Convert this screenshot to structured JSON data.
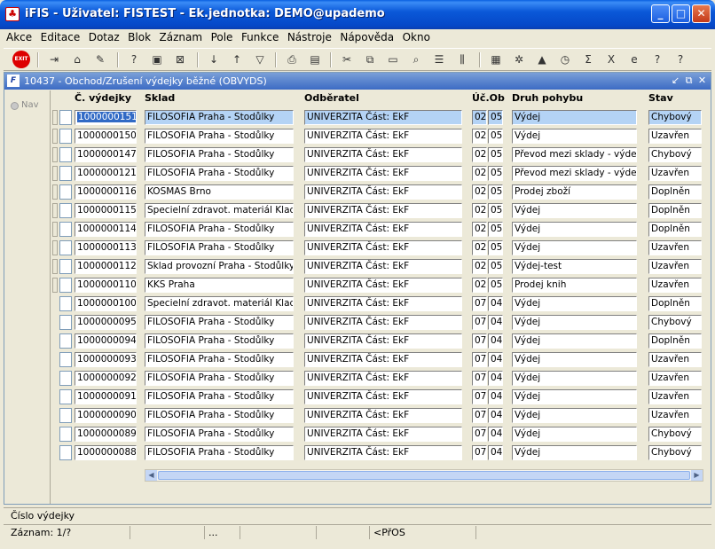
{
  "window": {
    "title": "iFIS - Uživatel: FISTEST - Ek.jednotka: DEMO@upademo",
    "app_icon": "iFIS-app-icon"
  },
  "menu": [
    "Akce",
    "Editace",
    "Dotaz",
    "Blok",
    "Záznam",
    "Pole",
    "Funkce",
    "Nástroje",
    "Nápověda",
    "Okno"
  ],
  "toolbar": {
    "exit_label": "EXIT"
  },
  "form": {
    "title": "10437 - Obchod/Zrušení výdejky běžné (OBVYDS)",
    "nav_label": "Nav"
  },
  "columns": {
    "cislo": "Č. výdejky",
    "sklad": "Sklad",
    "odberatel": "Odběratel",
    "ucob": "Úč.Ob",
    "druh": "Druh pohybu",
    "stav": "Stav"
  },
  "rows": [
    {
      "cislo": "1000000151",
      "sklad": "FILOSOFIA Praha - Stodůlky",
      "odberatel": "UNIVERZITA Část: EkF",
      "uc": "02",
      "ob": "05",
      "druh": "Výdej",
      "stav": "Chybový"
    },
    {
      "cislo": "1000000150",
      "sklad": "FILOSOFIA Praha - Stodůlky",
      "odberatel": "UNIVERZITA Část: EkF",
      "uc": "02",
      "ob": "05",
      "druh": "Výdej",
      "stav": "Uzavřen"
    },
    {
      "cislo": "1000000147",
      "sklad": "FILOSOFIA Praha - Stodůlky",
      "odberatel": "UNIVERZITA Část: EkF",
      "uc": "02",
      "ob": "05",
      "druh": "Převod mezi sklady - výdej",
      "stav": "Chybový"
    },
    {
      "cislo": "1000000121",
      "sklad": "FILOSOFIA Praha - Stodůlky",
      "odberatel": "UNIVERZITA Část: EkF",
      "uc": "02",
      "ob": "05",
      "druh": "Převod mezi sklady - výdej",
      "stav": "Uzavřen"
    },
    {
      "cislo": "1000000116",
      "sklad": "KOSMAS Brno",
      "odberatel": "UNIVERZITA Část: EkF",
      "uc": "02",
      "ob": "05",
      "druh": "Prodej zboží",
      "stav": "Doplněn"
    },
    {
      "cislo": "1000000115",
      "sklad": "Specielní zdravot. materiál Kladno",
      "odberatel": "UNIVERZITA Část: EkF",
      "uc": "02",
      "ob": "05",
      "druh": "Výdej",
      "stav": "Doplněn"
    },
    {
      "cislo": "1000000114",
      "sklad": "FILOSOFIA Praha - Stodůlky",
      "odberatel": "UNIVERZITA Část: EkF",
      "uc": "02",
      "ob": "05",
      "druh": "Výdej",
      "stav": "Doplněn"
    },
    {
      "cislo": "1000000113",
      "sklad": "FILOSOFIA Praha - Stodůlky",
      "odberatel": "UNIVERZITA Část: EkF",
      "uc": "02",
      "ob": "05",
      "druh": "Výdej",
      "stav": "Uzavřen"
    },
    {
      "cislo": "1000000112",
      "sklad": "Sklad provozní Praha - Stodůlky",
      "odberatel": "UNIVERZITA Část: EkF",
      "uc": "02",
      "ob": "05",
      "druh": "Výdej-test",
      "stav": "Uzavřen"
    },
    {
      "cislo": "1000000110",
      "sklad": "KKS Praha",
      "odberatel": "UNIVERZITA Část: EkF",
      "uc": "02",
      "ob": "05",
      "druh": "Prodej knih",
      "stav": "Uzavřen"
    },
    {
      "cislo": "1000000100",
      "sklad": "Specielní zdravot. materiál Kladno",
      "odberatel": "UNIVERZITA Část: EkF",
      "uc": "07",
      "ob": "04",
      "druh": "Výdej",
      "stav": "Doplněn"
    },
    {
      "cislo": "1000000095",
      "sklad": "FILOSOFIA Praha - Stodůlky",
      "odberatel": "UNIVERZITA Část: EkF",
      "uc": "07",
      "ob": "04",
      "druh": "Výdej",
      "stav": "Chybový"
    },
    {
      "cislo": "1000000094",
      "sklad": "FILOSOFIA Praha - Stodůlky",
      "odberatel": "UNIVERZITA Část: EkF",
      "uc": "07",
      "ob": "04",
      "druh": "Výdej",
      "stav": "Doplněn"
    },
    {
      "cislo": "1000000093",
      "sklad": "FILOSOFIA Praha - Stodůlky",
      "odberatel": "UNIVERZITA Část: EkF",
      "uc": "07",
      "ob": "04",
      "druh": "Výdej",
      "stav": "Uzavřen"
    },
    {
      "cislo": "1000000092",
      "sklad": "FILOSOFIA Praha - Stodůlky",
      "odberatel": "UNIVERZITA Část: EkF",
      "uc": "07",
      "ob": "04",
      "druh": "Výdej",
      "stav": "Uzavřen"
    },
    {
      "cislo": "1000000091",
      "sklad": "FILOSOFIA Praha - Stodůlky",
      "odberatel": "UNIVERZITA Část: EkF",
      "uc": "07",
      "ob": "04",
      "druh": "Výdej",
      "stav": "Uzavřen"
    },
    {
      "cislo": "1000000090",
      "sklad": "FILOSOFIA Praha - Stodůlky",
      "odberatel": "UNIVERZITA Část: EkF",
      "uc": "07",
      "ob": "04",
      "druh": "Výdej",
      "stav": "Uzavřen"
    },
    {
      "cislo": "1000000089",
      "sklad": "FILOSOFIA Praha - Stodůlky",
      "odberatel": "UNIVERZITA Část: EkF",
      "uc": "07",
      "ob": "04",
      "druh": "Výdej",
      "stav": "Chybový"
    },
    {
      "cislo": "1000000088",
      "sklad": "FILOSOFIA Praha - Stodůlky",
      "odberatel": "UNIVERZITA Část: EkF",
      "uc": "07",
      "ob": "04",
      "druh": "Výdej",
      "stav": "Chybový"
    }
  ],
  "status": {
    "field_hint": "Číslo výdejky",
    "record": "Záznam: 1/?",
    "dots": "...",
    "mode": "<PřOS"
  },
  "colors": {
    "title_blue": "#0548c8",
    "selection": "#316ac5",
    "selected_row": "#b4d3f5"
  }
}
